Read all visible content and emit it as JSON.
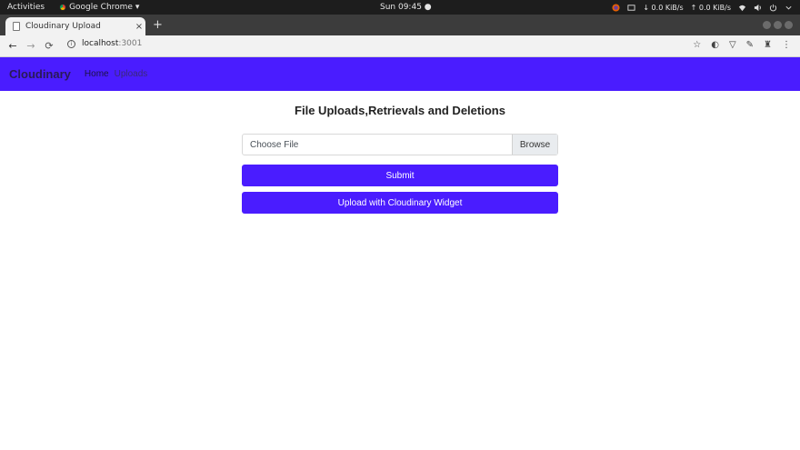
{
  "os_bar": {
    "activities": "Activities",
    "app_name": "Google Chrome ▾",
    "clock": "Sun 09:45 ●",
    "net_down": "↓ 0.0 KiB/s",
    "net_up": "↑ 0.0 KiB/s"
  },
  "browser": {
    "tab_title": "Cloudinary Upload",
    "tab_close": "×",
    "new_tab": "+",
    "url_host": "localhost",
    "url_port": ":3001"
  },
  "navbar": {
    "brand": "Cloudinary",
    "links": [
      "Home",
      "Uploads"
    ]
  },
  "main": {
    "title": "File Uploads,Retrievals and Deletions",
    "file_placeholder": "Choose File",
    "browse_label": "Browse",
    "submit_label": "Submit",
    "widget_label": "Upload with Cloudinary Widget"
  },
  "colors": {
    "accent": "#4a1cff"
  }
}
